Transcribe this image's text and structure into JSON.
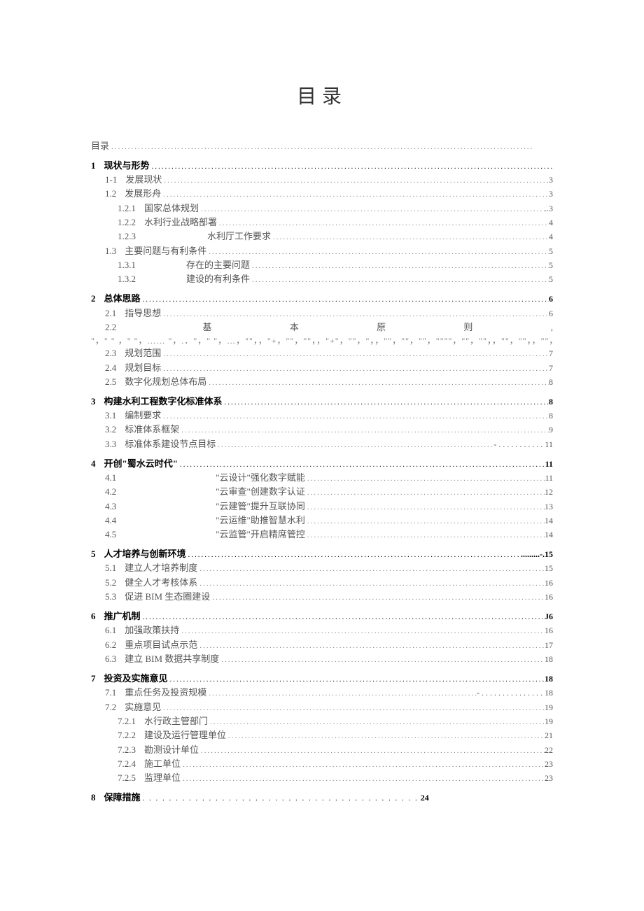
{
  "title": "目录",
  "dots_long": "...............................................................................................................................",
  "entries": [
    {
      "level": 1,
      "num": "",
      "label": "目录",
      "page": "",
      "first": true
    },
    {
      "level": 1,
      "num": "1",
      "label": "现状与形势",
      "page": "",
      "bold": true
    },
    {
      "level": 2,
      "num": "1-1",
      "label": "发展现状",
      "page": "3"
    },
    {
      "level": 2,
      "num": "1.2",
      "label": "发展形舟",
      "page": "3"
    },
    {
      "level": 3,
      "num": "1.2.1",
      "label": "国家总体规划",
      "page": "..3"
    },
    {
      "level": 3,
      "num": "1.2.2",
      "label": "水利行业战略部署",
      "page": "4"
    },
    {
      "level": 3,
      "num": "1.2.3",
      "label": "水利厅工作要求",
      "page": "4",
      "label_pad": 90
    },
    {
      "level": 2,
      "num": "1.3",
      "label": "主要问题与有利条件",
      "page": "5"
    },
    {
      "level": 3,
      "num": "1.3.1",
      "label": "存在的主要问题",
      "page": "5",
      "label_pad": 60
    },
    {
      "level": 3,
      "num": "1.3.2",
      "label": "建设的有利条件",
      "page": "5",
      "label_pad": 60
    },
    {
      "level": 1,
      "num": "2",
      "label": "总体思路",
      "page": "6",
      "bold": true
    },
    {
      "level": 2,
      "num": "2.1",
      "label": "指导思想",
      "page": "6"
    },
    {
      "level": 2,
      "num": "2.2",
      "label": "基本原则",
      "page": "",
      "special": "justify22",
      "segs": [
        "基",
        "本",
        "原",
        "则",
        ","
      ]
    },
    {
      "level": 0,
      "num": "",
      "label": "\"，\" \"  ，\"  \"，……  \"，.．\"，\"  \"，…，\"\"，，\"+，\"\"，\"\"，，\"+\"，\"\"，\"，，\"\"，\"\"，\"\"，\"\"\"\"，\"\"，\"\"，，\"\"，\"\"，，\"\"，\"\"，\"，\"，，\"．6",
      "page": "",
      "garble": true
    },
    {
      "level": 2,
      "num": "2.3",
      "label": "规划范围",
      "page": "7"
    },
    {
      "level": 2,
      "num": "2.4",
      "label": "规划目标",
      "page": "7"
    },
    {
      "level": 2,
      "num": "2.5",
      "label": "数字化规划总体布局",
      "page": "8"
    },
    {
      "level": 1,
      "num": "3",
      "label": "构建水利工程数字化标准体系",
      "page": "8",
      "bold": true
    },
    {
      "level": 2,
      "num": "3.1",
      "label": "编制要求",
      "page": "8"
    },
    {
      "level": 2,
      "num": "3.2",
      "label": "标准体系框架",
      "page": "9"
    },
    {
      "level": 2,
      "num": "3.3",
      "label": "标准体系建设节点目标",
      "page": "- . . . . . . . . . . . 11"
    },
    {
      "level": 1,
      "num": "4",
      "label": "开创\"蜀水云时代\"",
      "page": "11",
      "bold": true
    },
    {
      "level": 2,
      "num": "4.1",
      "label": "\"云设计\"强化数字赋能",
      "page": "11",
      "label_pad": 130
    },
    {
      "level": 2,
      "num": "4.2",
      "label": "\"云审查\"创建数字认证",
      "page": "12",
      "label_pad": 130
    },
    {
      "level": 2,
      "num": "4.3",
      "label": "\"云建管\"提升互联协同",
      "page": "13",
      "label_pad": 130
    },
    {
      "level": 2,
      "num": "4.4",
      "label": "\"云运维\"助推智慧水利",
      "page": "14",
      "label_pad": 130
    },
    {
      "level": 2,
      "num": "4.5",
      "label": "\"云监管\"开启精席管控",
      "page": "14",
      "label_pad": 130
    },
    {
      "level": 1,
      "num": "5",
      "label": "人才培养与创新环境",
      "page": ".........-.15",
      "bold": true
    },
    {
      "level": 2,
      "num": "5.1",
      "label": "建立人才培养制度",
      "page": "15"
    },
    {
      "level": 2,
      "num": "5.2",
      "label": "健全人才考核体系",
      "page": "16"
    },
    {
      "level": 2,
      "num": "5.3",
      "label": "促进 BIM 生态圈建设",
      "page": "16"
    },
    {
      "level": 1,
      "num": "6",
      "label": "推广机制",
      "page": "J6",
      "bold": true
    },
    {
      "level": 2,
      "num": "6.1",
      "label": "加强政策扶持",
      "page": "16"
    },
    {
      "level": 2,
      "num": "6.2",
      "label": "重点项目试点示范",
      "page": "17"
    },
    {
      "level": 2,
      "num": "6.3",
      "label": "建立 BIM 数据共享制度",
      "page": "18"
    },
    {
      "level": 1,
      "num": "7",
      "label": "投资及实施意见",
      "page": "18",
      "bold": true
    },
    {
      "level": 2,
      "num": "7.1",
      "label": "重点任务及投资规模",
      "page": "-  . . . . . . . . . . . . . . . 18"
    },
    {
      "level": 2,
      "num": "7.2",
      "label": "实施意见",
      "page": "19"
    },
    {
      "level": 3,
      "num": "7.2.1",
      "label": "水行政主管部门",
      "page": "19"
    },
    {
      "level": 3,
      "num": "7.2.2",
      "label": "建设及运行管理单位",
      "page": "21"
    },
    {
      "level": 3,
      "num": "7.2.3",
      "label": "勘测设计单位",
      "page": "22"
    },
    {
      "level": 3,
      "num": "7.2.4",
      "label": "施工单位",
      "page": "23"
    },
    {
      "level": 3,
      "num": "7.2.5",
      "label": "监理单位",
      "page": "23"
    },
    {
      "level": 1,
      "num": "8",
      "label": "保障措施",
      "page": "24",
      "bold": true,
      "short_dots": true
    }
  ]
}
